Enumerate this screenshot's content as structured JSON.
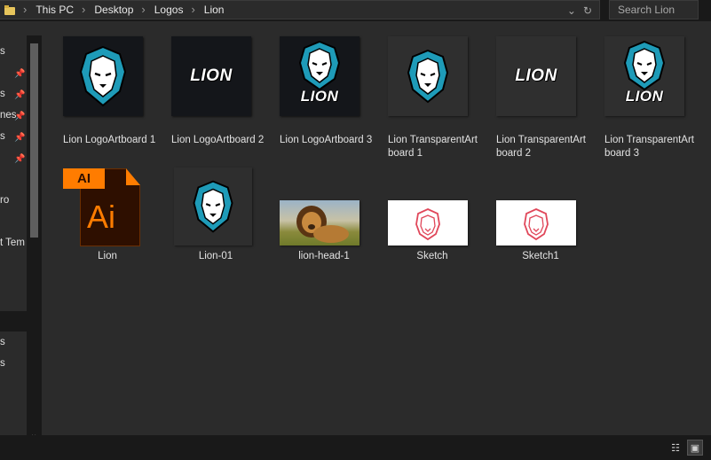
{
  "address": {
    "breadcrumbs": [
      "This PC",
      "Desktop",
      "Logos",
      "Lion"
    ],
    "dropdown_icon": "chevron-down-icon",
    "refresh_icon": "refresh-icon"
  },
  "search": {
    "placeholder": "Search Lion"
  },
  "nav": {
    "items": [
      "s",
      "s",
      "nes",
      "s",
      "",
      "ro",
      "t Tem"
    ],
    "lower_items": [
      "s",
      "s"
    ]
  },
  "files": [
    {
      "name": "Lion LogoArtboard 1",
      "kind": "dark-logo-icon"
    },
    {
      "name": "Lion LogoArtboard 2",
      "kind": "dark-wordmark",
      "wordmark": "LION"
    },
    {
      "name": "Lion LogoArtboard 3",
      "kind": "dark-logo-wordmark",
      "wordmark": "LION"
    },
    {
      "name": "Lion TransparentArtboard 1",
      "kind": "transparent-logo-icon"
    },
    {
      "name": "Lion TransparentArtboard 2",
      "kind": "transparent-wordmark",
      "wordmark": "LION"
    },
    {
      "name": "Lion TransparentArtboard 3",
      "kind": "transparent-logo-wordmark",
      "wordmark": "LION"
    },
    {
      "name": "Lion",
      "kind": "illustrator-file",
      "badge": "AI",
      "app_mark": "Ai"
    },
    {
      "name": "Lion-01",
      "kind": "transparent-logo-icon"
    },
    {
      "name": "lion-head-1",
      "kind": "photo"
    },
    {
      "name": "Sketch",
      "kind": "white-sketch"
    },
    {
      "name": "Sketch1",
      "kind": "white-sketch"
    }
  ],
  "colors": {
    "accent_teal": "#1e9bb8",
    "illustrator_orange": "#ff7c00",
    "sketch_red": "#e0475a"
  },
  "view_buttons": [
    "details-view-icon",
    "large-icons-view-icon"
  ]
}
